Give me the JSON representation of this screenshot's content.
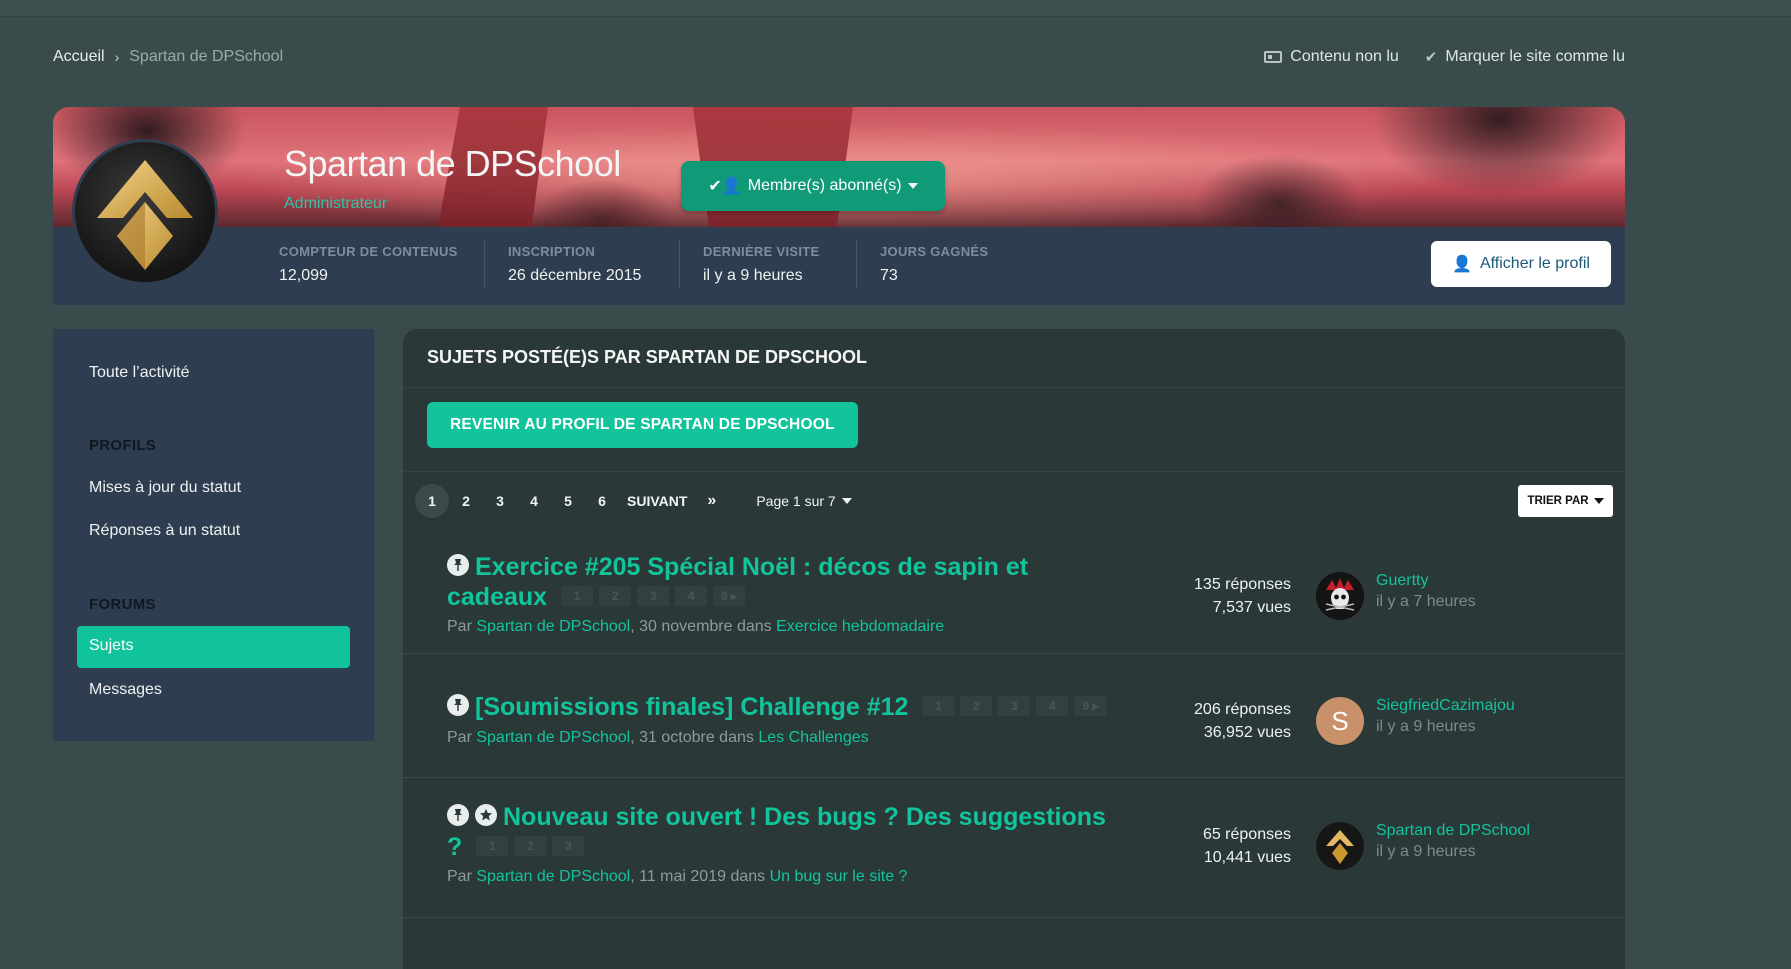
{
  "breadcrumb": {
    "home": "Accueil",
    "separator": "›",
    "current": "Spartan de DPSchool"
  },
  "top_actions": {
    "unread": "Contenu non lu",
    "mark_read": "Marquer le site comme lu"
  },
  "profile": {
    "name": "Spartan de DPSchool",
    "role": "Administrateur",
    "follow_label": "Membre(s) abonné(s)",
    "view_profile_label": "Afficher le profil",
    "stats": [
      {
        "label": "COMPTEUR DE CONTENUS",
        "value": "12,099"
      },
      {
        "label": "INSCRIPTION",
        "value": "26 décembre 2015"
      },
      {
        "label": "DERNIÈRE VISITE",
        "value": "il y a 9 heures"
      },
      {
        "label": "JOURS GAGNÉS",
        "value": "73"
      }
    ]
  },
  "sidebar": {
    "all_activity": "Toute l’activité",
    "profiles_heading": "PROFILS",
    "status_updates": "Mises à jour du statut",
    "status_replies": "Réponses à un statut",
    "forums_heading": "FORUMS",
    "topics": "Sujets",
    "posts": "Messages"
  },
  "main": {
    "title": "SUJETS POSTÉ(E)S PAR SPARTAN DE DPSCHOOL",
    "back_button": "REVENIR AU PROFIL DE SPARTAN DE DPSCHOOL",
    "pagination": {
      "pages": [
        "1",
        "2",
        "3",
        "4",
        "5",
        "6"
      ],
      "next": "SUIVANT",
      "last": "»",
      "jump": "Page 1 sur 7"
    },
    "sort_label": "TRIER PAR",
    "topics": [
      {
        "title_line1": "Exercice #205 Spécial Noël : décos de sapin et",
        "title_line2": "cadeaux",
        "mini_pages": [
          "1",
          "2",
          "3",
          "4",
          "6 ▸"
        ],
        "by": "Par",
        "author": "Spartan de DPSchool",
        "date": ", 30 novembre dans",
        "forum": "Exercice hebdomadaire",
        "replies": "135 réponses",
        "views": "7,537 vues",
        "last_user": "Guertty",
        "last_time": "il y a 7 heures"
      },
      {
        "title_line1": "[Soumissions finales] Challenge #12",
        "mini_pages": [
          "1",
          "2",
          "3",
          "4",
          "9 ▸"
        ],
        "by": "Par",
        "author": "Spartan de DPSchool",
        "date": ", 31 octobre dans",
        "forum": "Les Challenges",
        "replies": "206 réponses",
        "views": "36,952 vues",
        "last_user": "SiegfriedCazimajou",
        "last_user_initial": "S",
        "last_time": "il y a 9 heures"
      },
      {
        "title_line1": "Nouveau site ouvert ! Des bugs ? Des suggestions",
        "title_line2": "?",
        "mini_pages": [
          "1",
          "2",
          "3"
        ],
        "by": "Par",
        "author": "Spartan de DPSchool",
        "date": ", 11 mai 2019 dans",
        "forum": "Un bug sur le site ?",
        "replies": "65 réponses",
        "views": "10,441 vues",
        "last_user": "Spartan de DPSchool",
        "last_time": "il y a 9 heures"
      }
    ]
  },
  "colors": {
    "accent": "#12c49c",
    "panel": "#2e3d4f",
    "background": "#3a4b4c"
  }
}
